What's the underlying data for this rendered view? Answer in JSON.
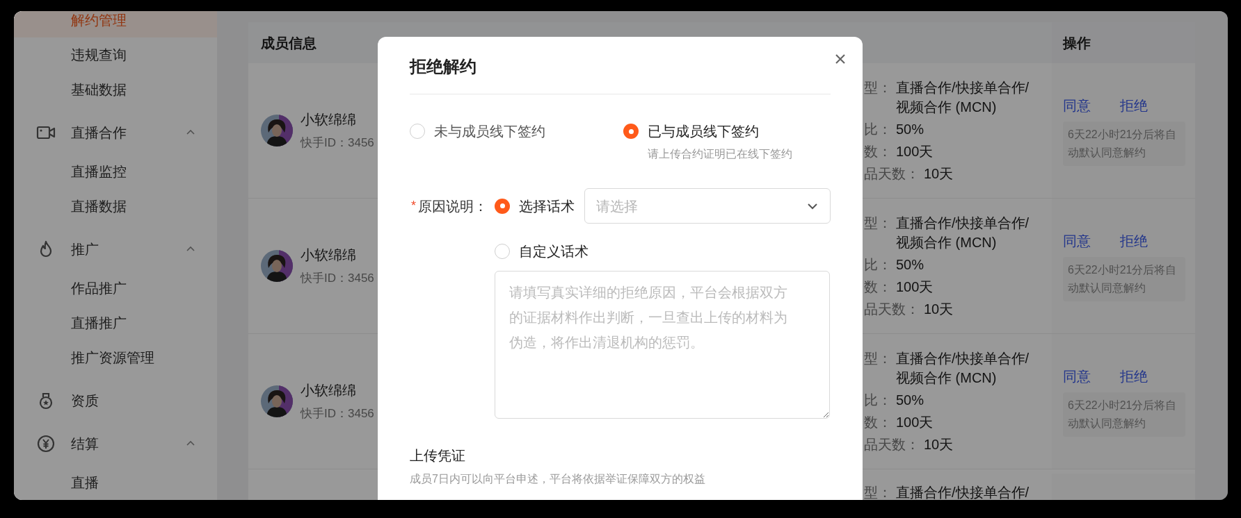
{
  "sidebar": {
    "items": [
      {
        "label": "解约管理",
        "selected": true
      },
      {
        "label": "违规查询",
        "selected": false
      },
      {
        "label": "基础数据",
        "selected": false
      }
    ],
    "groups": [
      {
        "label": "直播合作",
        "expanded": true,
        "children": [
          {
            "label": "直播监控",
            "selected": false
          },
          {
            "label": "直播数据",
            "selected": false
          }
        ]
      },
      {
        "label": "推广",
        "expanded": true,
        "children": [
          {
            "label": "作品推广",
            "selected": false
          },
          {
            "label": "直播推广",
            "selected": false
          },
          {
            "label": "推广资源管理",
            "selected": false
          }
        ]
      },
      {
        "label": "资质"
      },
      {
        "label": "结算",
        "expanded": true,
        "children": [
          {
            "label": "直播",
            "selected": false
          }
        ]
      }
    ]
  },
  "table": {
    "member_column": "成员信息",
    "action_column": "操作",
    "rows": [
      {
        "name": "小软绵绵",
        "id": "快手ID：3456",
        "cooperation": [
          {
            "label": "型：",
            "value": "直播合作/快接单合作/视频合作 (MCN)"
          },
          {
            "label": "比：",
            "value": "50%"
          },
          {
            "label": "数：",
            "value": "100天"
          },
          {
            "label": "品天数：",
            "value": "10天"
          }
        ],
        "actions": [
          "同意",
          "拒绝"
        ],
        "countdown": "6天22小时21分后将自动默认同意解约"
      },
      {
        "name": "小软绵绵",
        "id": "快手ID：3456",
        "cooperation": [
          {
            "label": "型：",
            "value": "直播合作/快接单合作/视频合作 (MCN)"
          },
          {
            "label": "比：",
            "value": "50%"
          },
          {
            "label": "数：",
            "value": "100天"
          },
          {
            "label": "品天数：",
            "value": "10天"
          }
        ],
        "actions": [
          "同意",
          "拒绝"
        ],
        "countdown": "6天22小时21分后将自动默认同意解约"
      },
      {
        "name": "小软绵绵",
        "id": "快手ID：3456",
        "cooperation": [
          {
            "label": "型：",
            "value": "直播合作/快接单合作/视频合作 (MCN)"
          },
          {
            "label": "比：",
            "value": "50%"
          },
          {
            "label": "数：",
            "value": "100天"
          },
          {
            "label": "品天数：",
            "value": "10天"
          }
        ],
        "actions": [
          "同意",
          "拒绝"
        ],
        "countdown": "6天22小时21分后将自动默认同意解约"
      },
      {
        "cooperation": [
          {
            "label": "型：",
            "value": "直播合作/快接单合作/"
          }
        ]
      }
    ]
  },
  "dialog": {
    "title": "拒绝解约",
    "sign_options": [
      {
        "label": "未与成员线下签约",
        "selected": false
      },
      {
        "label": "已与成员线下签约",
        "selected": true,
        "hint": "请上传合约证明已在线下签约"
      }
    ],
    "reason": {
      "required_mark": "*",
      "label": "原因说明：",
      "options": [
        {
          "kind": "select",
          "label": "选择话术",
          "selected": true,
          "placeholder": "请选择"
        },
        {
          "kind": "textarea",
          "label": "自定义话术",
          "selected": false,
          "placeholder": "请填写真实详细的拒绝原因，平台会根据双方的证据材料作出判断，一旦查出上传的材料为伪造，将作出清退机构的惩罚。"
        }
      ]
    },
    "upload": {
      "title": "上传凭证",
      "hint": "成员7日内可以向平台申述，平台将依据举证保障双方的权益"
    }
  }
}
